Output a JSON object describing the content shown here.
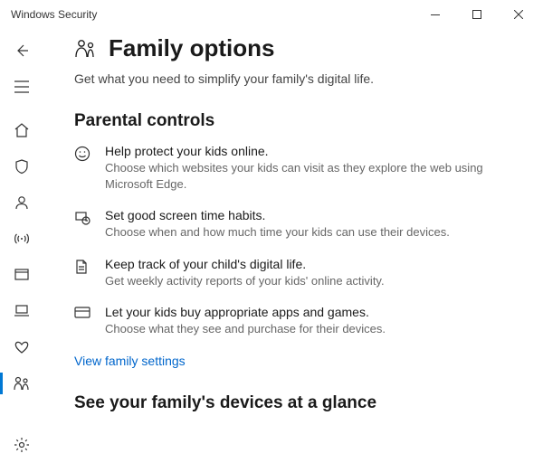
{
  "window": {
    "title": "Windows Security"
  },
  "sidebar": {
    "items": [
      {
        "name": "back",
        "icon": "arrow-left"
      },
      {
        "name": "menu",
        "icon": "hamburger"
      },
      {
        "name": "home",
        "icon": "home"
      },
      {
        "name": "virus",
        "icon": "shield"
      },
      {
        "name": "account",
        "icon": "person"
      },
      {
        "name": "firewall",
        "icon": "broadcast"
      },
      {
        "name": "app-browser",
        "icon": "app-window"
      },
      {
        "name": "device-security",
        "icon": "laptop"
      },
      {
        "name": "device-performance",
        "icon": "heart"
      },
      {
        "name": "family",
        "icon": "family",
        "active": true
      }
    ],
    "bottom": {
      "name": "settings",
      "icon": "gear"
    }
  },
  "page": {
    "title": "Family options",
    "subtitle": "Get what you need to simplify your family's digital life."
  },
  "section1": {
    "heading": "Parental controls",
    "features": [
      {
        "title": "Help protect your kids online.",
        "desc": "Choose which websites your kids can visit as they explore the web using Microsoft Edge."
      },
      {
        "title": "Set good screen time habits.",
        "desc": "Choose when and how much time your kids can use their devices."
      },
      {
        "title": "Keep track of your child's digital life.",
        "desc": "Get weekly activity reports of your kids' online activity."
      },
      {
        "title": "Let your kids buy appropriate apps and games.",
        "desc": "Choose what they see and purchase for their devices."
      }
    ],
    "link": "View family settings"
  },
  "section2": {
    "heading": "See your family's devices at a glance"
  }
}
